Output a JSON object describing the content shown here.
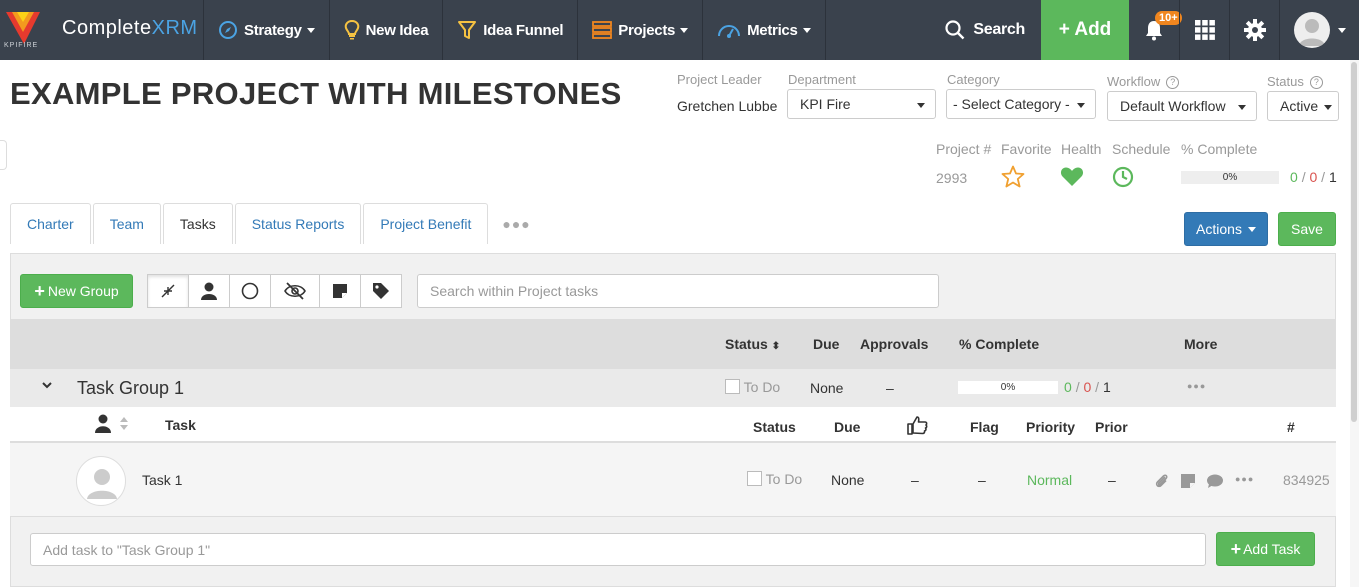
{
  "nav": {
    "brand_small": "KPIFIRE",
    "brand_part1": "Complete",
    "brand_part2": "XRM",
    "items": [
      {
        "label": "Strategy",
        "icon": "compass-icon"
      },
      {
        "label": "New Idea",
        "icon": "lightbulb-icon"
      },
      {
        "label": "Idea Funnel",
        "icon": "funnel-icon"
      },
      {
        "label": "Projects",
        "icon": "projects-icon"
      },
      {
        "label": "Metrics",
        "icon": "gauge-icon"
      }
    ],
    "search_label": "Search",
    "add_label": "+ Add",
    "notif_badge": "10+",
    "colors": {
      "bar": "#3a424d",
      "add": "#5cb85c",
      "badge": "#f0861f"
    }
  },
  "project": {
    "title": "EXAMPLE PROJECT WITH MILESTONES",
    "leader_label": "Project Leader",
    "leader": "Gretchen Lubbe",
    "department_label": "Department",
    "department": "KPI Fire",
    "category_label": "Category",
    "category": "- Select Category -",
    "workflow_label": "Workflow",
    "workflow": "Default Workflow",
    "status_label": "Status",
    "status": "Active",
    "number_label": "Project #",
    "number": "2993",
    "favorite_label": "Favorite",
    "health_label": "Health",
    "schedule_label": "Schedule",
    "complete_label": "% Complete",
    "complete_value": "0%",
    "complete_fraction": 0,
    "counts": [
      "0",
      "0",
      "1"
    ]
  },
  "tabs": [
    "Charter",
    "Team",
    "Tasks",
    "Status Reports",
    "Project Benefit"
  ],
  "actions_label": "Actions",
  "save_label": "Save",
  "toolbar": {
    "new_group_label": "New Group",
    "search_placeholder": "Search within Project tasks"
  },
  "columns": {
    "status": "Status",
    "due": "Due",
    "approvals": "Approvals",
    "complete": "% Complete",
    "more": "More"
  },
  "group": {
    "name": "Task Group 1",
    "status": "To Do",
    "due": "None",
    "approvals": "–",
    "complete": "0%",
    "complete_fraction": 0,
    "counts": [
      "0",
      "0",
      "1"
    ]
  },
  "task_columns": {
    "task": "Task",
    "status": "Status",
    "due": "Due",
    "flag": "Flag",
    "priority": "Priority",
    "prior": "Prior",
    "number": "#"
  },
  "task": {
    "name": "Task 1",
    "status": "To Do",
    "due": "None",
    "approval": "–",
    "flag": "–",
    "priority": "Normal",
    "prior": "–",
    "number": "834925"
  },
  "add_task_placeholder": "Add task to \"Task Group 1\"",
  "add_task_label": "Add Task"
}
